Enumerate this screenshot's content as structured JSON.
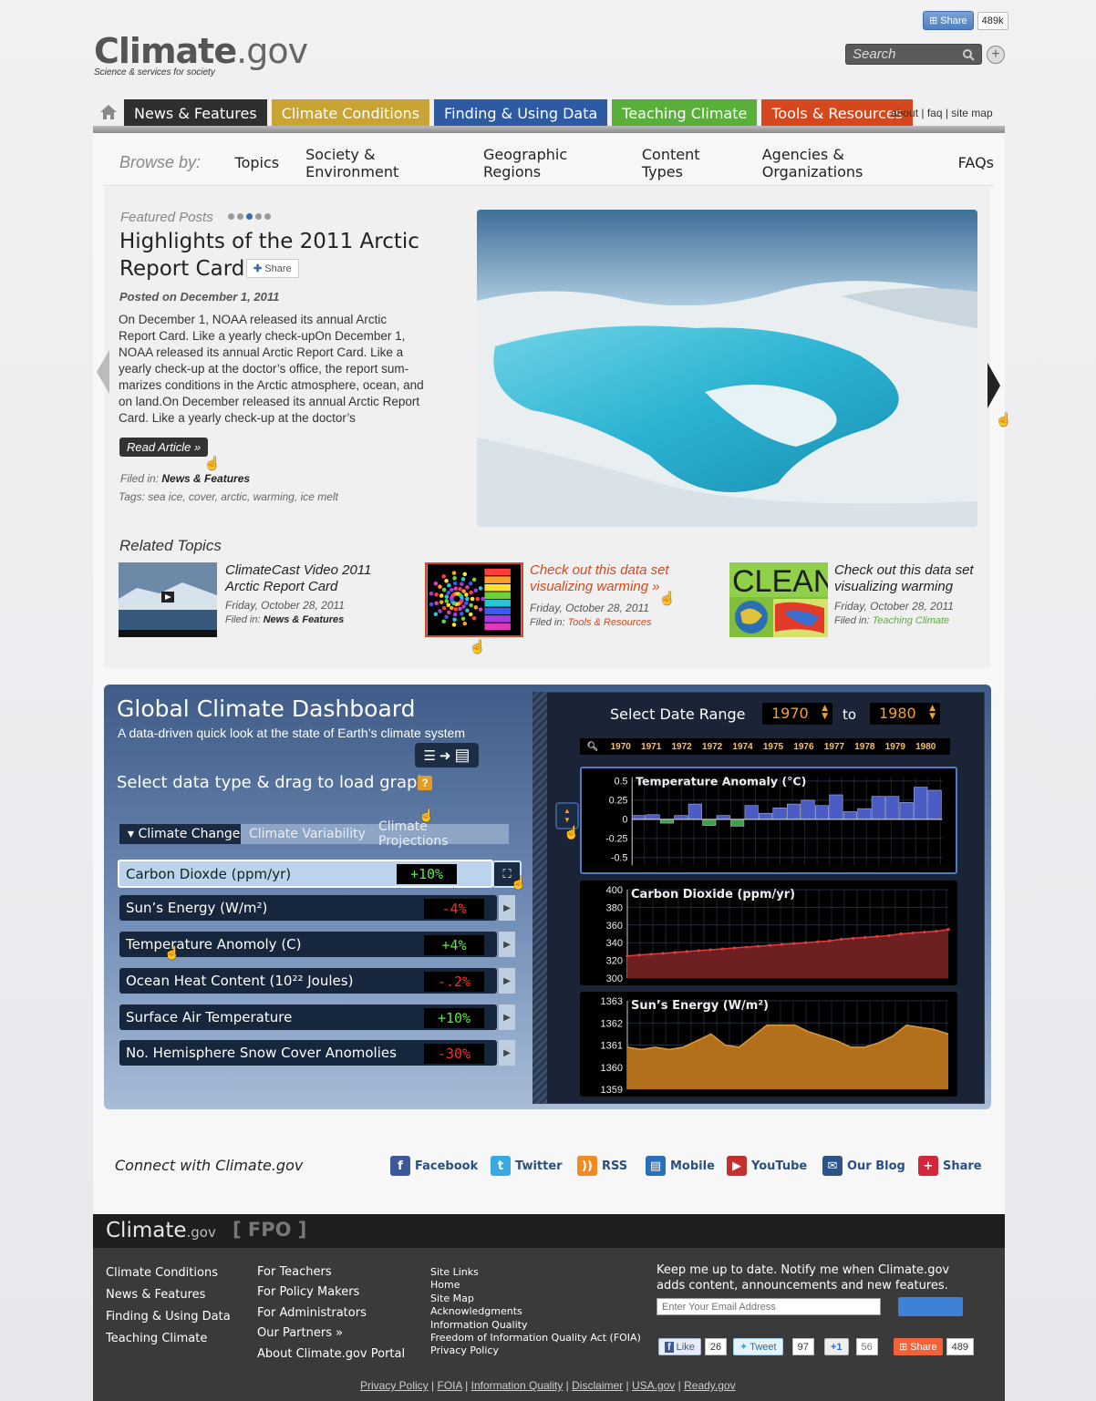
{
  "topshare": {
    "label": "Share",
    "count": "489k"
  },
  "logo": {
    "name": "Climate",
    "tld": ".gov",
    "tagline": "Science & services for society"
  },
  "search": {
    "placeholder": "Search"
  },
  "nav": {
    "tabs": [
      {
        "label": "News & Features",
        "color": "#2f2f2f"
      },
      {
        "label": "Climate Conditions",
        "color": "#c9a333"
      },
      {
        "label": "Finding & Using Data",
        "color": "#2d5aa3"
      },
      {
        "label": "Teaching Climate",
        "color": "#5aae3a"
      },
      {
        "label": "Tools & Resources",
        "color": "#d5481e"
      }
    ],
    "links": "about | faq | site map"
  },
  "browse": {
    "label": "Browse by:",
    "items": [
      "Topics",
      "Society & Environment",
      "Geographic Regions",
      "Content Types",
      "Agencies & Organizations",
      "FAQs"
    ]
  },
  "featured": {
    "label": "Featured Posts",
    "title": "Highlights of the 2011 Arctic Report Card",
    "share": "Share",
    "date": "Posted on December 1, 2011",
    "body": "On December 1, NOAA released its annual Arctic Report Card. Like a yearly check-upOn December 1, NOAA released its annual Arctic Report Card. Like a yearly check-up at the doctor’s office, the report sum-marizes conditions in the Arctic atmosphere, ocean, and on land.On December released its annual Arctic Report Card. Like a yearly check-up at the doctor’s",
    "read": "Read Article »",
    "filed_label": "Filed in:",
    "filed": "News & Features",
    "tags": "Tags: sea ice, cover, arctic, warming, ice melt"
  },
  "related": {
    "label": "Related Topics",
    "items": [
      {
        "title": "ClimateCast Video 2011 Arctic Report Card",
        "date": "Friday, October 28, 2011",
        "filed_label": "Filed in:",
        "filed": "News & Features",
        "color": "#222222"
      },
      {
        "title": "Check out this data set visualizing warming »",
        "date": "Friday, October 28, 2011",
        "filed_label": "Filed in:",
        "filed": "Tools & Resources",
        "color": "#d5481e"
      },
      {
        "title": "Check out this data set visualizing warming",
        "date": "Friday, October 28, 2011",
        "filed_label": "Filed in:",
        "filed": "Teaching Climate",
        "color": "#5aae3a"
      }
    ],
    "clean_text": "CLEAN"
  },
  "dashboard": {
    "title": "Global Climate Dashboard",
    "subtitle": "A data-driven quick look at the state of Earth’s climate system",
    "select": "Select data type & drag to load graph.",
    "help": "?",
    "tabs": [
      "▾ Climate Change",
      "Climate Variability",
      "Climate Projections"
    ],
    "rows": [
      {
        "label": "Carbon Dioxde (ppm/yr)",
        "value": "+10%"
      },
      {
        "label": "Sun’s Energy (W/m²)",
        "value": "-4%"
      },
      {
        "label": "Temperature Anomoly (C)",
        "value": "+4%"
      },
      {
        "label": "Ocean Heat Content (10²² Joules)",
        "value": "-.2%"
      },
      {
        "label": "Surface Air Temperature",
        "value": "+10%"
      },
      {
        "label": "No. Hemisphere Snow Cover Anomolies",
        "value": "-30%"
      }
    ],
    "date_range_label": "Select Date Range",
    "from_year": "1970",
    "to_label": "to",
    "to_year": "1980",
    "timeline_years": [
      "1970",
      "1971",
      "1972",
      "1972",
      "1974",
      "1975",
      "1976",
      "1977",
      "1978",
      "1979",
      "1980"
    ]
  },
  "chart_data": [
    {
      "type": "bar",
      "title": "Temperature Anomaly (°C)",
      "yticks": [
        "0.5",
        "0.25",
        "0",
        "-0.25",
        "-0.5"
      ],
      "ylim": [
        -0.6,
        0.55
      ],
      "values": [
        0.05,
        0.06,
        -0.05,
        0.05,
        0.2,
        -0.08,
        0.05,
        -0.09,
        0.18,
        0.08,
        0.15,
        0.2,
        0.25,
        0.18,
        0.32,
        0.1,
        0.14,
        0.3,
        0.3,
        0.22,
        0.42,
        0.38
      ],
      "colors": {
        "positive": "#4b5cc4",
        "negative": "#3fa04a"
      }
    },
    {
      "type": "area",
      "title": "Carbon Dioxide (ppm/yr)",
      "yticks": [
        "400",
        "380",
        "360",
        "340",
        "320",
        "300"
      ],
      "ylim": [
        300,
        400
      ],
      "values": [
        325,
        326,
        327,
        328,
        329,
        330,
        331,
        332,
        333,
        334,
        335,
        336,
        337,
        338,
        339,
        340,
        341,
        342,
        344,
        345,
        346,
        347,
        348,
        350,
        351,
        352,
        353,
        355
      ],
      "colors": {
        "fill": "#6e1f22",
        "line": "#e23b3b"
      }
    },
    {
      "type": "area",
      "title": "Sun’s Energy (W/m²)",
      "yticks": [
        "1363",
        "1362",
        "1361",
        "1360",
        "1359"
      ],
      "ylim": [
        1359,
        1363
      ],
      "values": [
        1360.9,
        1360.8,
        1360.9,
        1360.8,
        1360.9,
        1361.2,
        1361.5,
        1361.0,
        1360.9,
        1361.4,
        1361.9,
        1361.9,
        1361.9,
        1361.6,
        1361.4,
        1361.2,
        1360.9,
        1360.9,
        1361.1,
        1361.4,
        1361.9,
        1361.8,
        1361.7,
        1361.5
      ],
      "colors": {
        "fill": "#b3701c",
        "line": "#d89a3a"
      }
    }
  ],
  "connect": {
    "label": "Connect with Climate.gov",
    "items": [
      {
        "label": "Facebook",
        "icon": "facebook-icon",
        "color": "#3b5998"
      },
      {
        "label": "Twitter",
        "icon": "twitter-icon",
        "color": "#3aa9e0"
      },
      {
        "label": "RSS",
        "icon": "rss-icon",
        "color": "#f08a24"
      },
      {
        "label": "Mobile",
        "icon": "mobile-icon",
        "color": "#2a6fbd"
      },
      {
        "label": "YouTube",
        "icon": "youtube-icon",
        "color": "#c4302b"
      },
      {
        "label": "Our Blog",
        "icon": "blog-icon",
        "color": "#2c5487"
      },
      {
        "label": "Share",
        "icon": "share-icon",
        "color": "#d4263a"
      }
    ]
  },
  "footer": {
    "logo": "Climate",
    "logo_tld": ".gov",
    "fpo": "[ FPO ]",
    "col1": [
      "Climate Conditions",
      "News & Features",
      "Finding & Using Data",
      "Teaching Climate"
    ],
    "col2": [
      "For Teachers",
      "For Policy Makers",
      "For Administrators",
      "Our Partners »",
      "About Climate.gov Portal"
    ],
    "col3": [
      "Site Links",
      "Home",
      "Site Map",
      "Acknowledgments",
      "Information Quality",
      "Freedom of Information Quality Act (FOIA)",
      "Privacy Policy"
    ],
    "notify": "Keep me up to date. Notify me when Climate.gov adds content, announcements and new features.",
    "email_placeholder": "Enter Your Email Address",
    "social": [
      {
        "label": "Like",
        "count": "26"
      },
      {
        "label": "Tweet",
        "count": "97"
      },
      {
        "label": "+1",
        "count": "56"
      },
      {
        "label": "Share",
        "count": "489"
      }
    ],
    "bottom_links": [
      "Privacy Policy",
      "FOIA",
      "Information Quality",
      "Disclaimer",
      "USA.gov",
      "Ready.gov"
    ]
  }
}
